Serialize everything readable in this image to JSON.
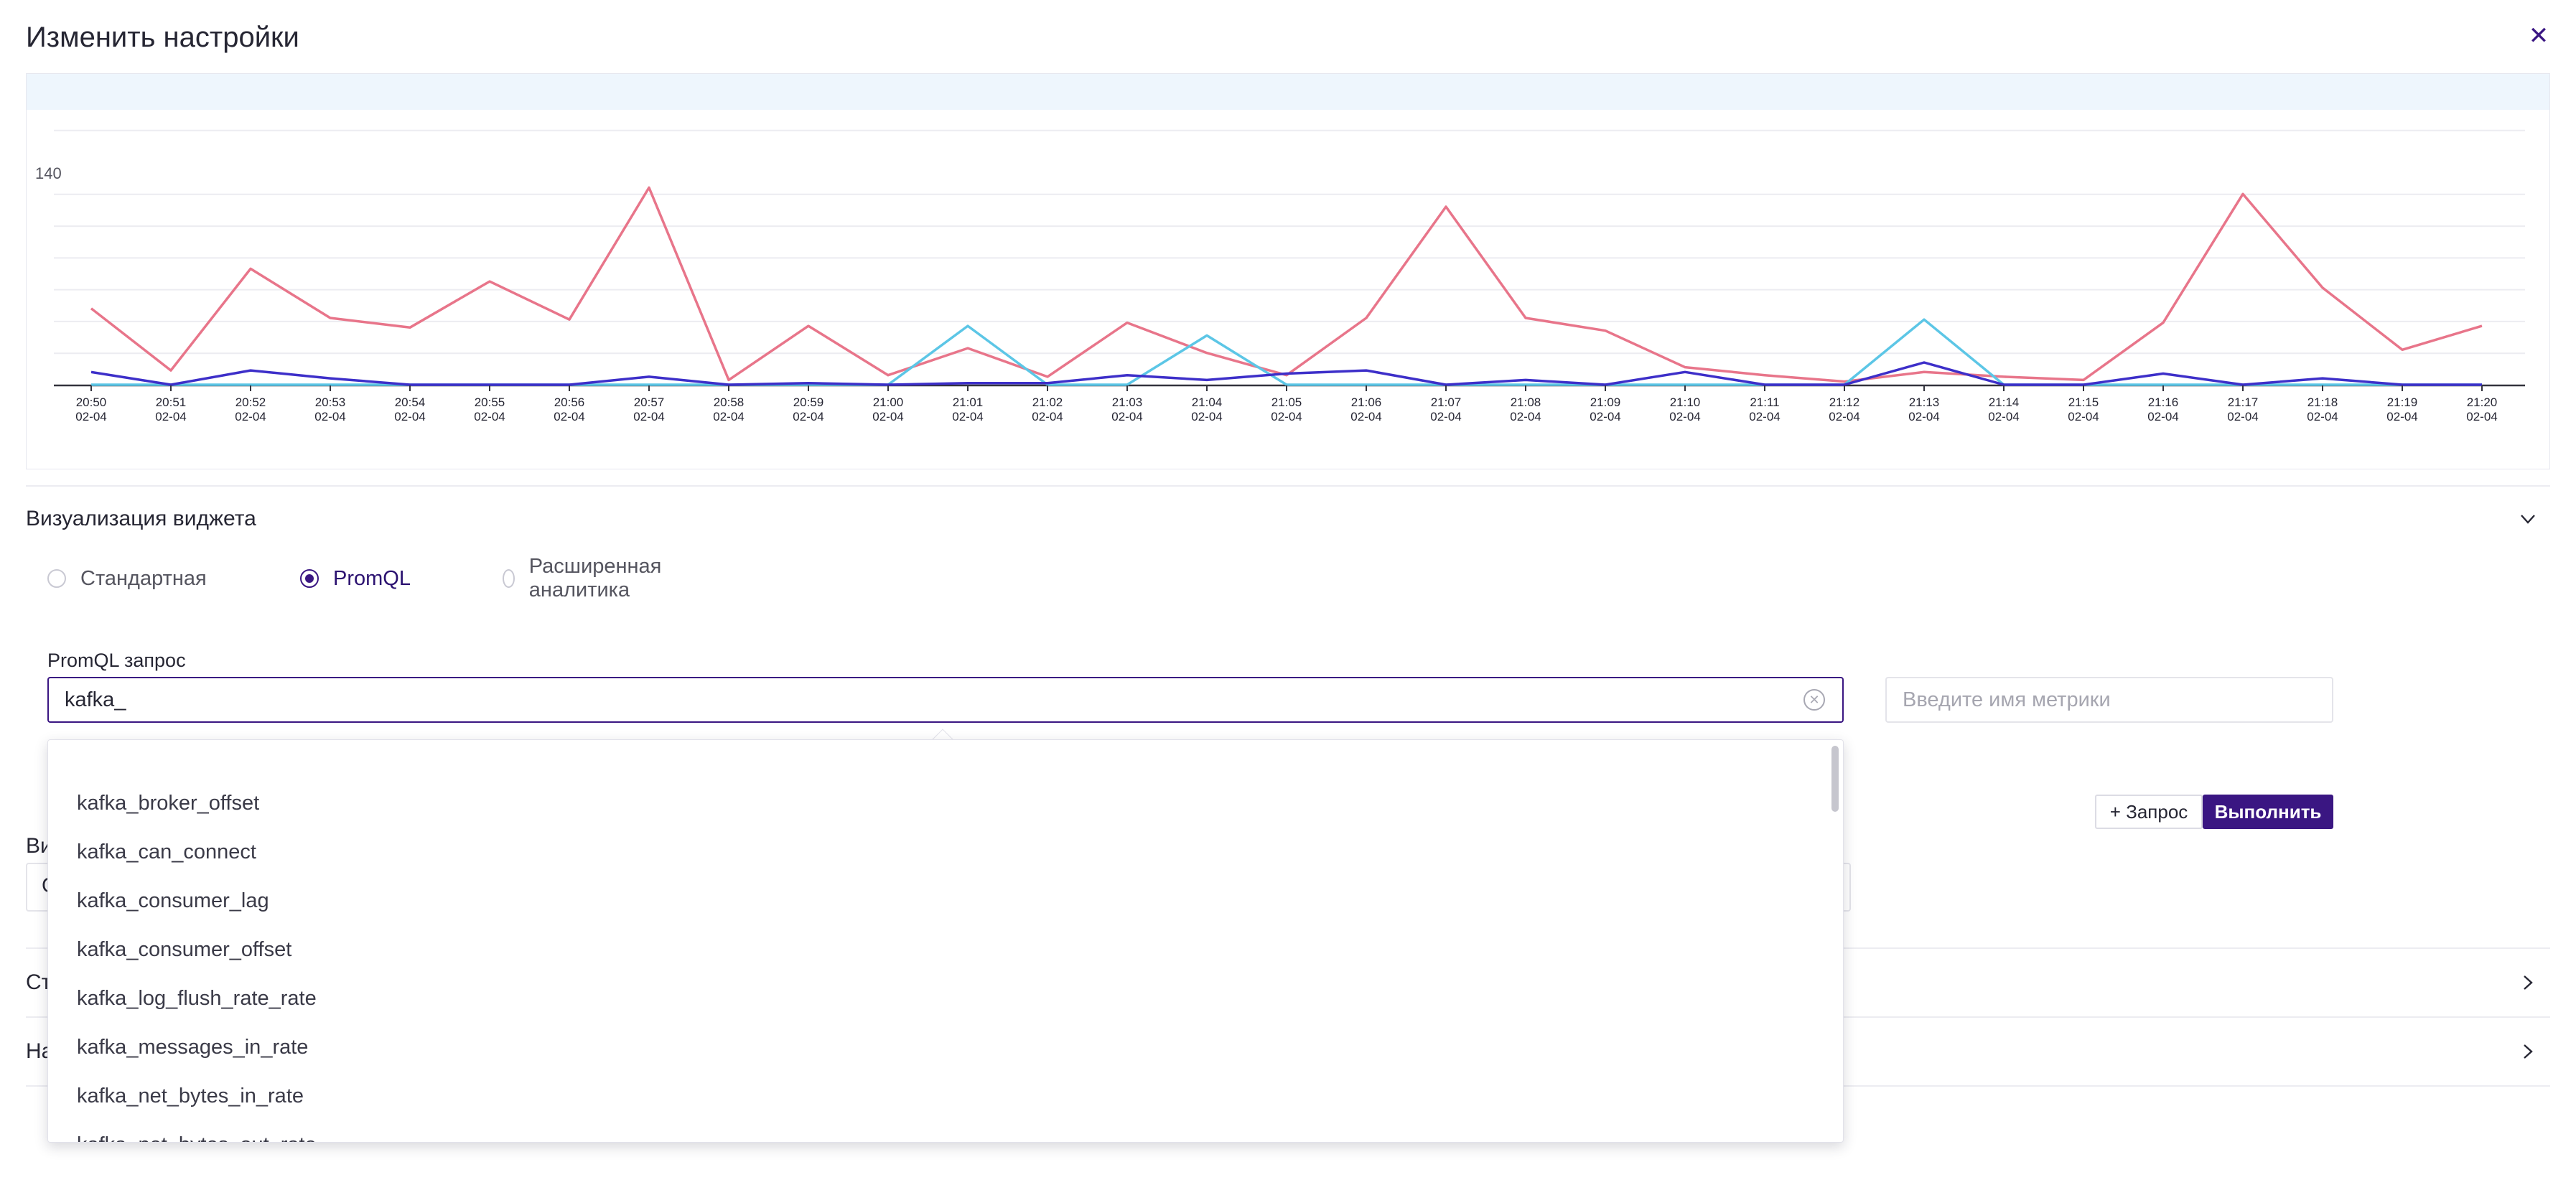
{
  "title": "Изменить настройки",
  "chart_data": {
    "type": "line",
    "y_tick_top": "140",
    "ylim": [
      0,
      140
    ],
    "x": [
      {
        "t": "20:50",
        "d": "02-04"
      },
      {
        "t": "20:51",
        "d": "02-04"
      },
      {
        "t": "20:52",
        "d": "02-04"
      },
      {
        "t": "20:53",
        "d": "02-04"
      },
      {
        "t": "20:54",
        "d": "02-04"
      },
      {
        "t": "20:55",
        "d": "02-04"
      },
      {
        "t": "20:56",
        "d": "02-04"
      },
      {
        "t": "20:57",
        "d": "02-04"
      },
      {
        "t": "20:58",
        "d": "02-04"
      },
      {
        "t": "20:59",
        "d": "02-04"
      },
      {
        "t": "21:00",
        "d": "02-04"
      },
      {
        "t": "21:01",
        "d": "02-04"
      },
      {
        "t": "21:02",
        "d": "02-04"
      },
      {
        "t": "21:03",
        "d": "02-04"
      },
      {
        "t": "21:04",
        "d": "02-04"
      },
      {
        "t": "21:05",
        "d": "02-04"
      },
      {
        "t": "21:06",
        "d": "02-04"
      },
      {
        "t": "21:07",
        "d": "02-04"
      },
      {
        "t": "21:08",
        "d": "02-04"
      },
      {
        "t": "21:09",
        "d": "02-04"
      },
      {
        "t": "21:10",
        "d": "02-04"
      },
      {
        "t": "21:11",
        "d": "02-04"
      },
      {
        "t": "21:12",
        "d": "02-04"
      },
      {
        "t": "21:13",
        "d": "02-04"
      },
      {
        "t": "21:14",
        "d": "02-04"
      },
      {
        "t": "21:15",
        "d": "02-04"
      },
      {
        "t": "21:16",
        "d": "02-04"
      },
      {
        "t": "21:17",
        "d": "02-04"
      },
      {
        "t": "21:18",
        "d": "02-04"
      },
      {
        "t": "21:19",
        "d": "02-04"
      },
      {
        "t": "21:20",
        "d": "02-04"
      }
    ],
    "grid": true,
    "series": [
      {
        "color": "#e8758a",
        "values": [
          48,
          9,
          73,
          42,
          36,
          65,
          41,
          124,
          3,
          37,
          6,
          23,
          5,
          39,
          20,
          6,
          42,
          112,
          42,
          34,
          11,
          6,
          2,
          8,
          5,
          3,
          39,
          120,
          61,
          22,
          37
        ]
      },
      {
        "color": "#5cc6e6",
        "values": [
          0,
          0,
          0,
          0,
          0,
          0,
          0,
          0,
          0,
          0,
          0,
          37,
          0,
          0,
          31,
          0,
          0,
          0,
          0,
          0,
          0,
          0,
          0,
          41,
          0,
          0,
          0,
          0,
          0,
          0,
          0
        ]
      },
      {
        "color": "#3d2fc9",
        "values": [
          8,
          0,
          9,
          4,
          0,
          0,
          0,
          5,
          0,
          1,
          0,
          1,
          1,
          6,
          3,
          7,
          9,
          0,
          3,
          0,
          8,
          0,
          0,
          14,
          0,
          0,
          7,
          0,
          4,
          0,
          0
        ]
      }
    ]
  },
  "widget_section": {
    "title": "Визуализация виджета",
    "options": [
      {
        "label": "Стандартная",
        "selected": false
      },
      {
        "label": "PromQL",
        "selected": true
      },
      {
        "label": "Расширенная аналитика",
        "selected": false
      }
    ]
  },
  "promql": {
    "label": "PromQL запрос",
    "value": "kafka_",
    "metric_placeholder": "Введите имя метрики"
  },
  "suggestions": [
    "kafka_broker_offset",
    "kafka_can_connect",
    "kafka_consumer_lag",
    "kafka_consumer_offset",
    "kafka_log_flush_rate_rate",
    "kafka_messages_in_rate",
    "kafka_net_bytes_in_rate",
    "kafka_net_bytes_out_rate"
  ],
  "buttons": {
    "add_query": "+ Запрос",
    "run": "Выполнить"
  },
  "hidden_peeks": {
    "vi": "Ви",
    "select_char": "С",
    "st": "Ст",
    "na": "На"
  },
  "colors": {
    "accent": "#3a1682",
    "chart_header_bg": "#eef6fd"
  }
}
